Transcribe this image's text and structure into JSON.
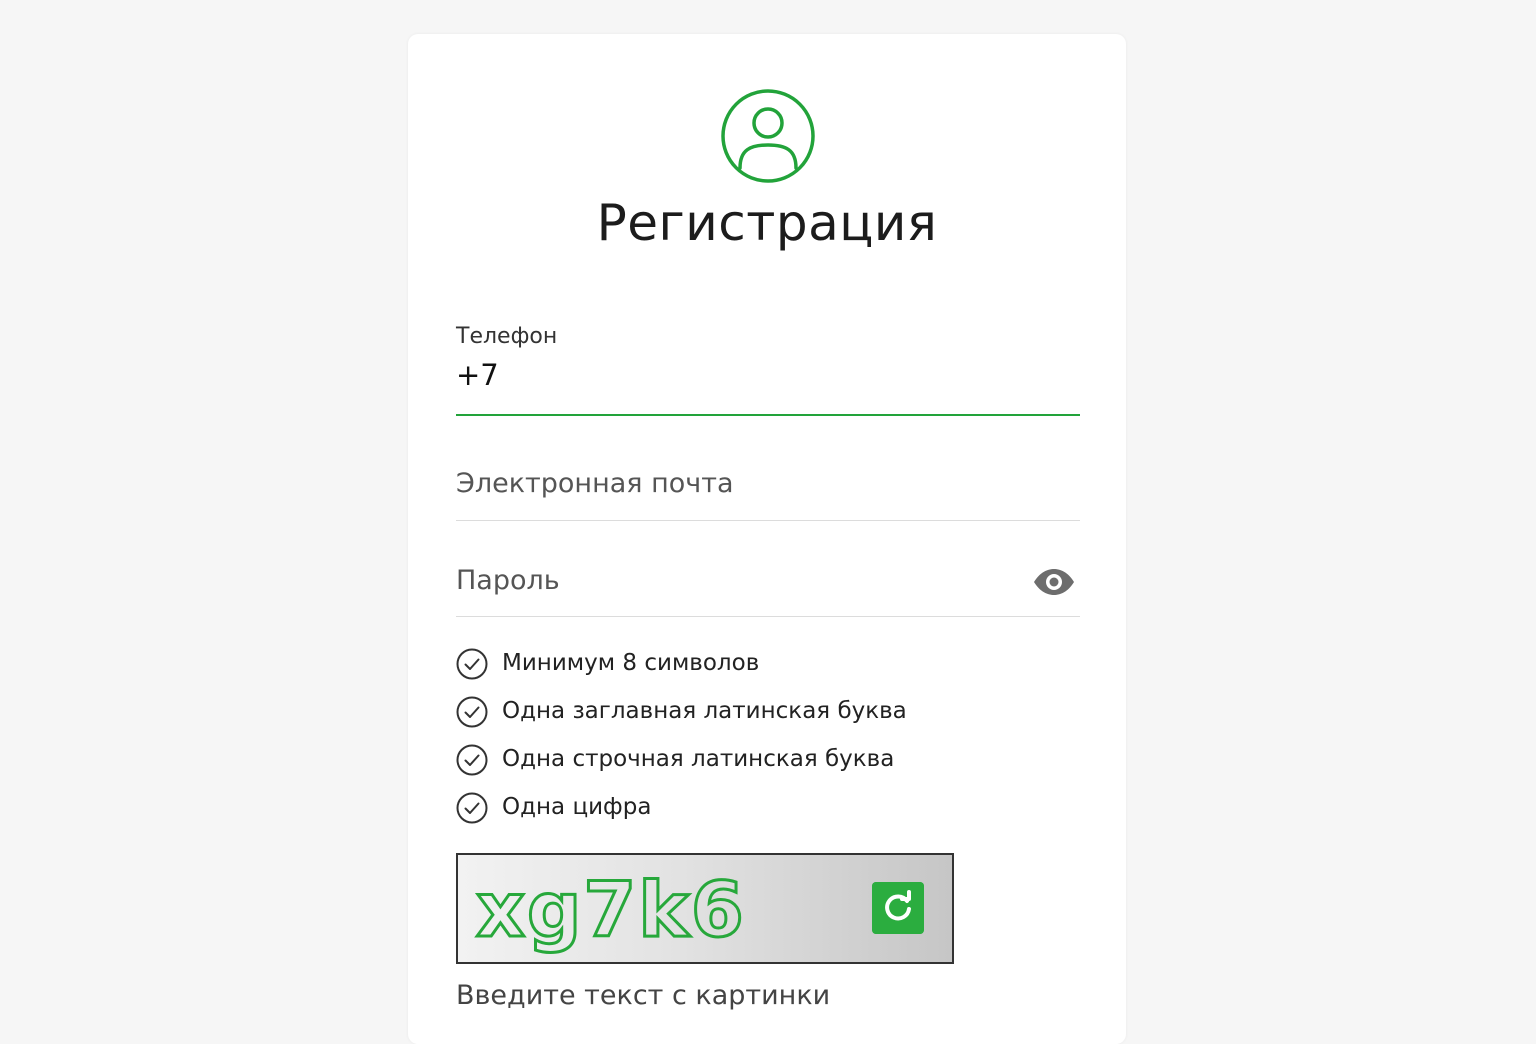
{
  "page": {
    "title": "Регистрация"
  },
  "colors": {
    "accent": "#22a33a",
    "background": "#f6f6f6",
    "card": "#ffffff"
  },
  "form": {
    "phone": {
      "label": "Телефон",
      "value": "+7"
    },
    "email": {
      "placeholder": "Электронная почта"
    },
    "password": {
      "placeholder": "Пароль",
      "toggle_icon": "eye-icon"
    },
    "password_rules": [
      {
        "text": "Минимум 8 символов",
        "icon": "check-circle-icon"
      },
      {
        "text": "Одна заглавная латинская буква",
        "icon": "check-circle-icon"
      },
      {
        "text": "Одна строчная латинская буква",
        "icon": "check-circle-icon"
      },
      {
        "text": "Одна цифра",
        "icon": "check-circle-icon"
      }
    ],
    "captcha": {
      "code": "xg7k6",
      "refresh_icon": "refresh-icon",
      "input_placeholder": "Введите текст с картинки"
    }
  }
}
